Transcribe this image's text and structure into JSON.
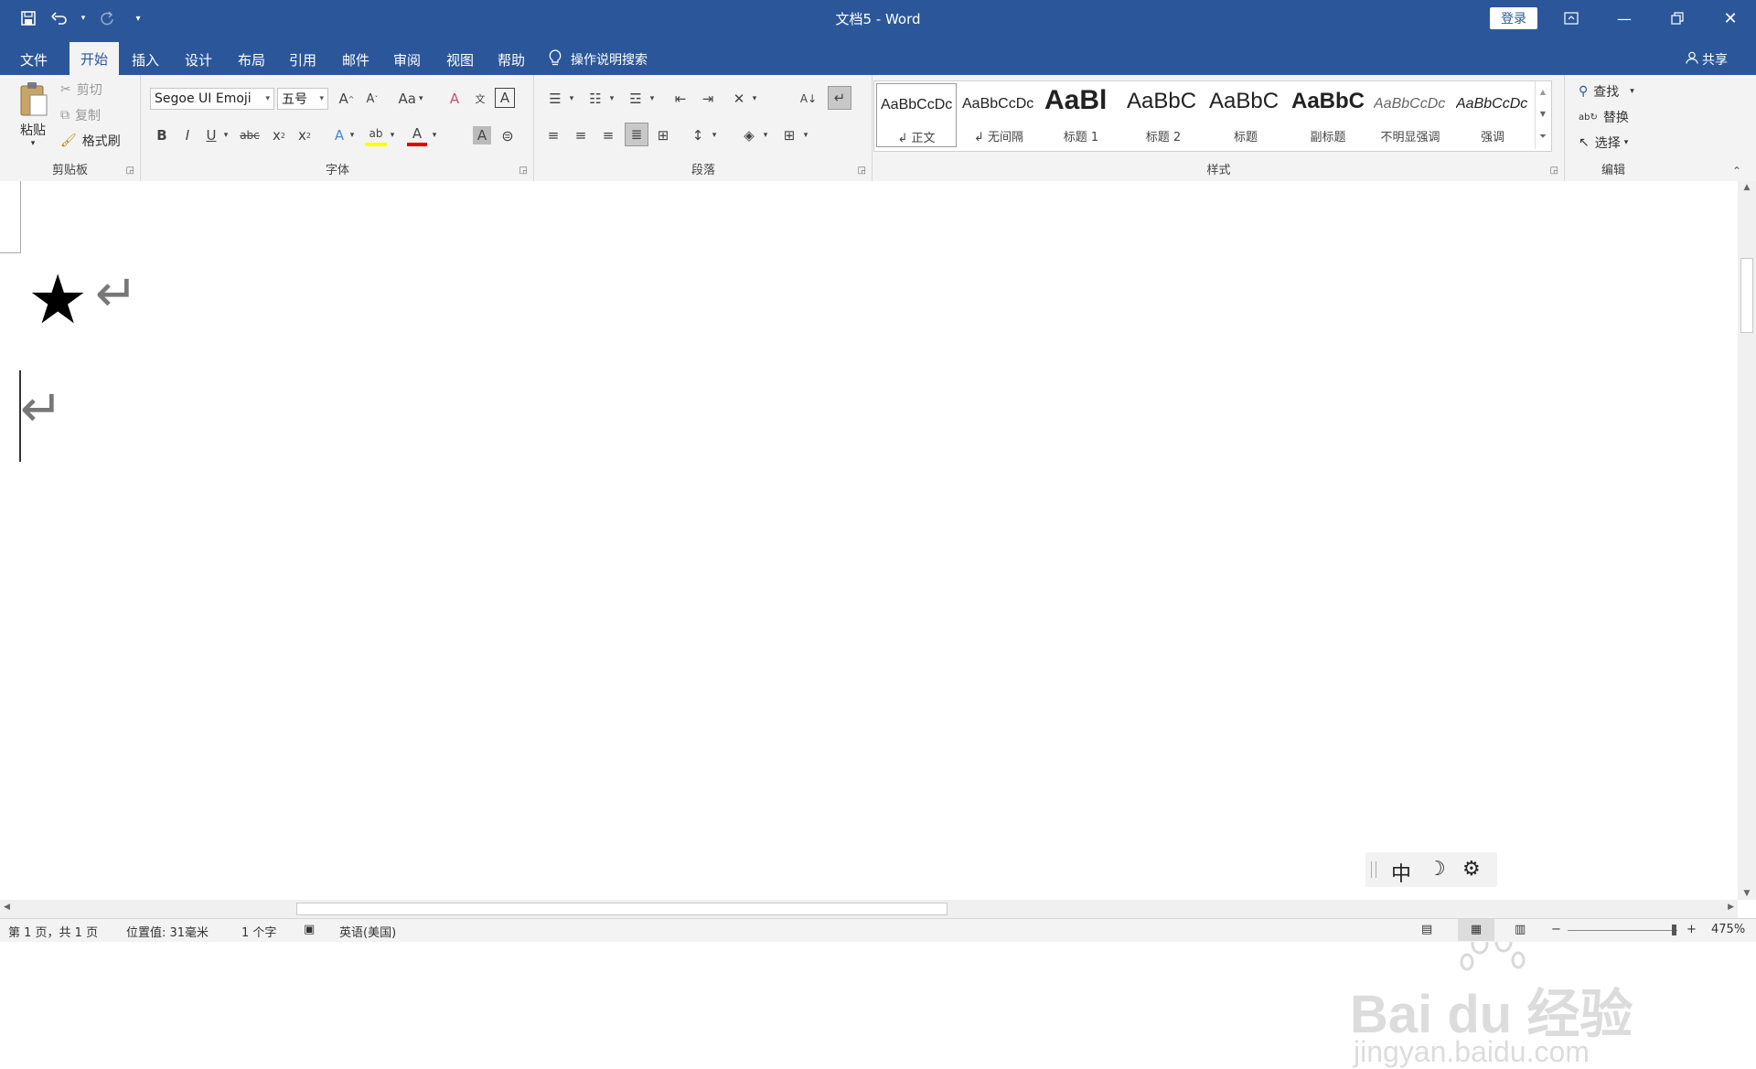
{
  "window": {
    "title": "文档5 - Word",
    "login_label": "登录"
  },
  "tabs": [
    "文件",
    "开始",
    "插入",
    "设计",
    "布局",
    "引用",
    "邮件",
    "审阅",
    "视图",
    "帮助"
  ],
  "tell_me": "操作说明搜索",
  "share_label": "共享",
  "clipboard": {
    "paste": "粘贴",
    "cut": "剪切",
    "copy": "复制",
    "format_painter": "格式刷",
    "group": "剪贴板"
  },
  "font": {
    "name": "Segoe UI Emoji",
    "size": "五号",
    "group": "字体"
  },
  "paragraph": {
    "group": "段落"
  },
  "styles": {
    "group": "样式",
    "items": [
      {
        "preview": "AaBbCcDc",
        "name": "↲ 正文"
      },
      {
        "preview": "AaBbCcDc",
        "name": "↲ 无间隔"
      },
      {
        "preview": "AaBl",
        "name": "标题 1"
      },
      {
        "preview": "AaBbC",
        "name": "标题 2"
      },
      {
        "preview": "AaBbC",
        "name": "标题"
      },
      {
        "preview": "AaBbC",
        "name": "副标题"
      },
      {
        "preview": "AaBbCcDc",
        "name": "不明显强调"
      },
      {
        "preview": "AaBbCcDc",
        "name": "强调"
      }
    ]
  },
  "editing": {
    "find": "查找",
    "replace": "替换",
    "select": "选择",
    "group": "编辑"
  },
  "document": {
    "star": "★",
    "para_mark": "↵"
  },
  "ime": {
    "mode": "中",
    "moon": "☽",
    "gear": "⚙"
  },
  "watermark": {
    "brand": "Bai du 经验",
    "url": "jingyan.baidu.com"
  },
  "status": {
    "page": "第 1 页，共 1 页",
    "position": "位置值: 31毫米",
    "words": "1 个字",
    "language": "英语(美国)",
    "zoom": "475%"
  }
}
